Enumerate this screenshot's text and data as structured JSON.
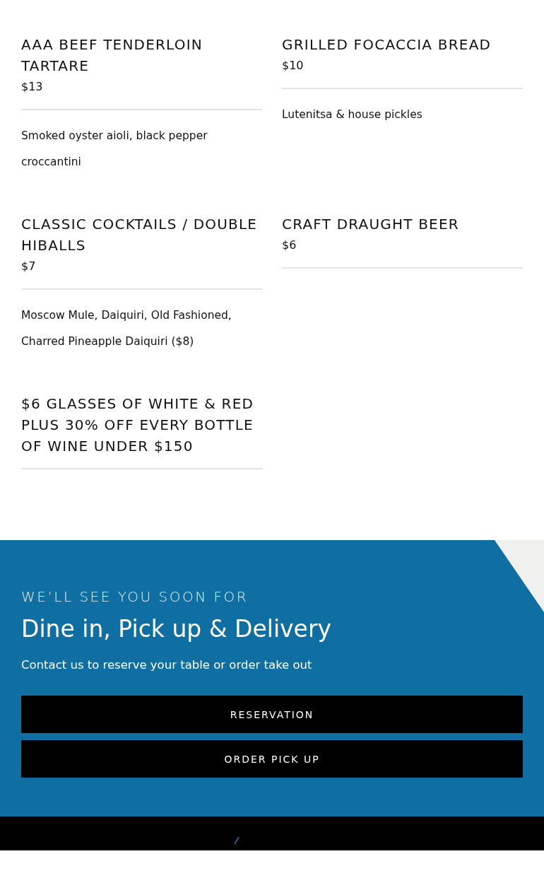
{
  "menu_items": [
    {
      "title": "AAA BEEF TENDERLOIN TARTARE",
      "price": "$13",
      "description": "Smoked oyster aioli, black pepper croccantini"
    },
    {
      "title": "GRILLED FOCACCIA BREAD",
      "price": "$10",
      "description": "Lutenitsa & house pickles"
    },
    {
      "title": "CLASSIC COCKTAILS / DOUBLE HIBALLS",
      "price": "$7",
      "description": "Moscow Mule, Daiquiri, Old Fashioned, Charred Pineapple Daiquiri ($8)"
    },
    {
      "title": "CRAFT DRAUGHT BEER",
      "price": "$6"
    },
    {
      "title": "$6 GLASSES OF WHITE & RED PLUS 30% OFF EVERY BOTTLE OF WINE UNDER $150"
    }
  ],
  "cta": {
    "eyebrow": "WE’LL SEE YOU SOON FOR",
    "heading": "Dine in, Pick up & Delivery",
    "text": "Contact us to reserve your table or order take out",
    "buttons": [
      "RESERVATION",
      "ORDER PICK UP"
    ]
  }
}
